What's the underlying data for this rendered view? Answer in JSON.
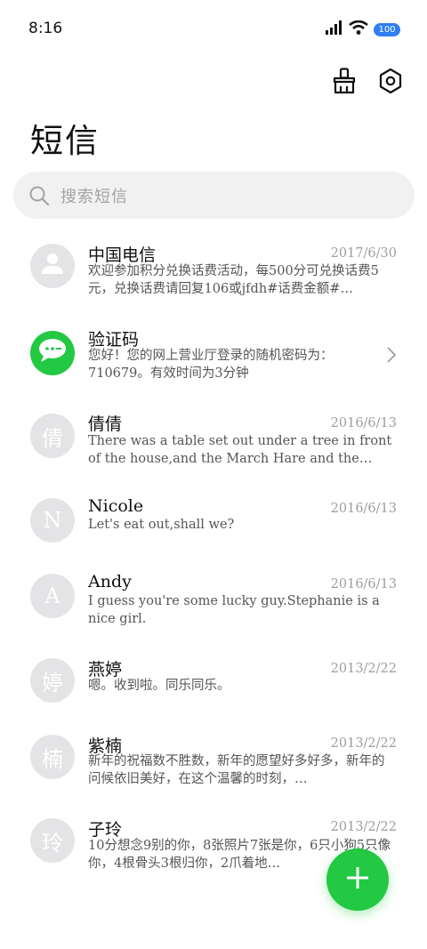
{
  "status_bar": {
    "time": "8:16",
    "battery_level": "100",
    "signal_icon": "signal-bars-icon",
    "wifi_icon": "wifi-icon"
  },
  "toolbar": {
    "clean_icon": "broom-icon",
    "settings_icon": "settings-icon"
  },
  "page": {
    "title": "短信"
  },
  "search": {
    "placeholder": "搜索短信"
  },
  "messages": [
    {
      "name": "中国电信",
      "date": "2017/6/30",
      "preview": "欢迎参加积分兑换话费活动，每500分可兑换话费5元，兑换话费请回复106或jfdh#话费金额#…",
      "avatar": "person-icon",
      "avatar_text": ""
    },
    {
      "name": "验证码",
      "date": "",
      "preview": "您好！您的网上营业厅登录的随机密码为：710679。有效时间为3分钟",
      "avatar": "sms-bubble-icon",
      "avatar_text": ""
    },
    {
      "name": "倩倩",
      "date": "2016/6/13",
      "preview": "There was a table set out under a tree in front of the house,and the March Hare and the Hatter…",
      "avatar": "",
      "avatar_text": "倩"
    },
    {
      "name": "Nicole",
      "date": "2016/6/13",
      "preview": "Let's eat out,shall we?",
      "avatar": "",
      "avatar_text": "N"
    },
    {
      "name": "Andy",
      "date": "2016/6/13",
      "preview": "I guess you're some lucky guy.Stephanie is a nice girl.",
      "avatar": "",
      "avatar_text": "A"
    },
    {
      "name": "燕婷",
      "date": "2013/2/22",
      "preview": "嗯。收到啦。同乐同乐。",
      "avatar": "",
      "avatar_text": "婷"
    },
    {
      "name": "紫楠",
      "date": "2013/2/22",
      "preview": "新年的祝福数不胜数，新年的愿望好多好多，新年的问候依旧美好，在这个温馨的时刻，…",
      "avatar": "",
      "avatar_text": "楠"
    },
    {
      "name": "子玲",
      "date": "2013/2/22",
      "preview": "10分想念9别的你，8张照片7张是你，6只小狗5只像你，4根骨头3根归你，2爪着地…",
      "avatar": "",
      "avatar_text": "玲"
    }
  ],
  "fab": {
    "icon": "plus-icon"
  },
  "colors": {
    "accent": "#23c843",
    "battery": "#2f7ef5",
    "avatar_bg": "#e4e4e6",
    "search_bg": "#f1f1f1"
  }
}
